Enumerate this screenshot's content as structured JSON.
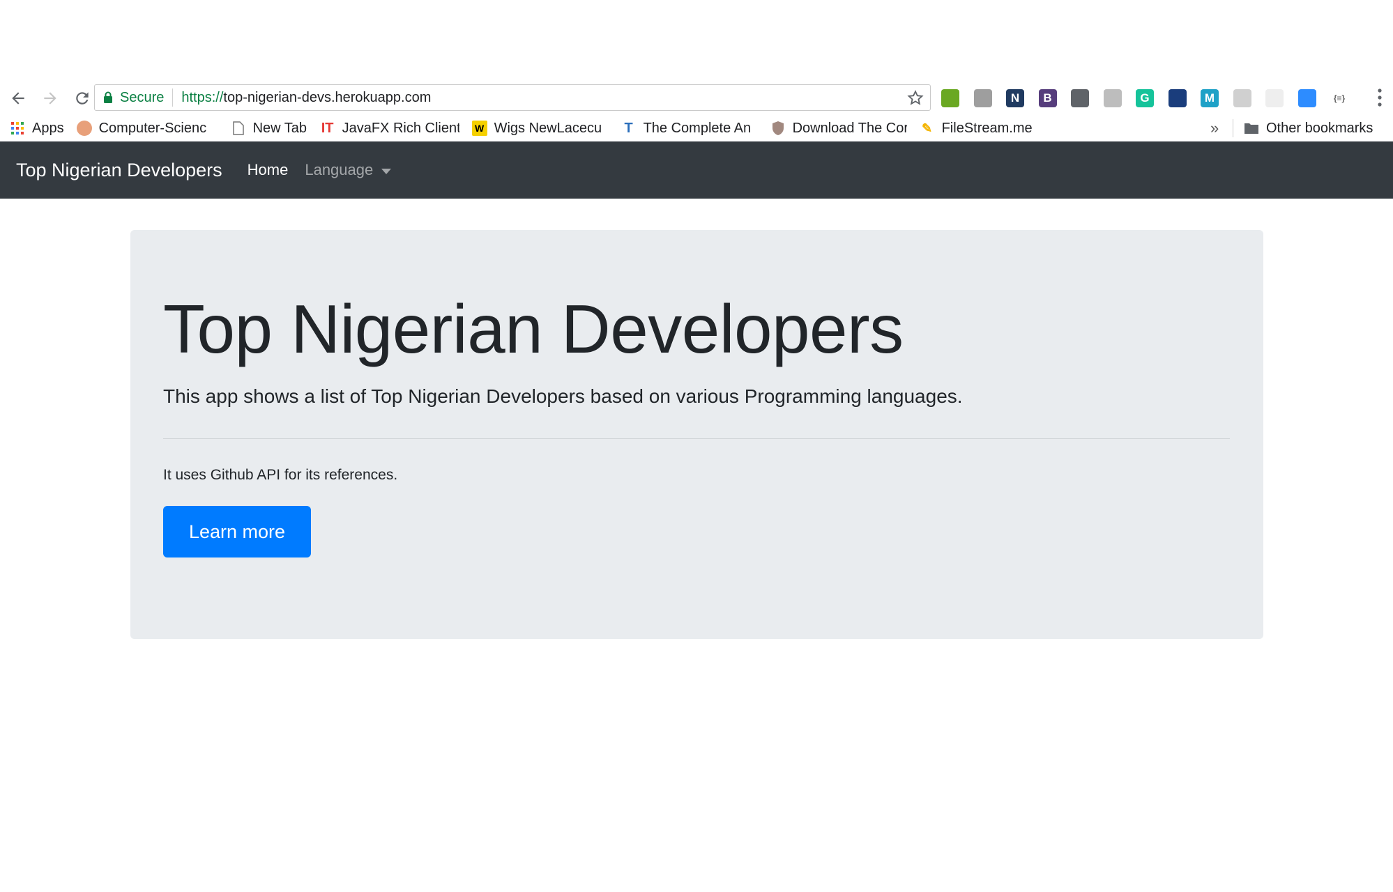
{
  "browser": {
    "secure_label": "Secure",
    "url_scheme": "https://",
    "url_host": "top-nigerian-devs.herokuapp.com",
    "extensions": [
      {
        "icon": "download-arrow-icon",
        "color": "#6aa822",
        "glyph": ""
      },
      {
        "icon": "gray-extension-icon",
        "color": "#9e9e9e",
        "glyph": ""
      },
      {
        "icon": "n-extension-icon",
        "color": "#1f3a60",
        "glyph": "N"
      },
      {
        "icon": "b-extension-icon",
        "color": "#563d7c",
        "glyph": "B"
      },
      {
        "icon": "bulb-extension-icon",
        "color": "#5f6368",
        "glyph": ""
      },
      {
        "icon": "globe-extension-icon",
        "color": "#bdbdbd",
        "glyph": ""
      },
      {
        "icon": "grammarly-icon",
        "color": "#15c39a",
        "glyph": "G"
      },
      {
        "icon": "chart-extension-icon",
        "color": "#1a3d7c",
        "glyph": ""
      },
      {
        "icon": "m-extension-icon",
        "color": "#1ea1c7",
        "glyph": "M"
      },
      {
        "icon": "chat-extension-icon",
        "color": "#d0d0d0",
        "glyph": ""
      },
      {
        "icon": "blank-extension-icon",
        "color": "#eeeeee",
        "glyph": ""
      },
      {
        "icon": "zoom-extension-icon",
        "color": "#2d8cff",
        "glyph": ""
      },
      {
        "icon": "json-extension-icon",
        "color": "#ffffff",
        "glyph": "{≡}"
      }
    ]
  },
  "bookmarks": {
    "apps": "Apps",
    "items": [
      {
        "label": "Computer-Scienc",
        "icon": "computer-science-icon"
      },
      {
        "label": "New Tab",
        "icon": "page-icon"
      },
      {
        "label": "JavaFX Rich Client",
        "icon": "it-icon"
      },
      {
        "label": "Wigs NewLacecu",
        "icon": "wigs-icon"
      },
      {
        "label": "The Complete An",
        "icon": "t-icon"
      },
      {
        "label": "Download The Cor",
        "icon": "shield-icon"
      },
      {
        "label": "FileStream.me",
        "icon": "filestream-icon"
      }
    ],
    "more": "»",
    "other": "Other bookmarks"
  },
  "navbar": {
    "brand": "Top Nigerian Developers",
    "home": "Home",
    "language": "Language"
  },
  "jumbotron": {
    "title": "Top Nigerian Developers",
    "lead": "This app shows a list of Top Nigerian Developers based on various Programming languages.",
    "text": "It uses Github API for its references.",
    "button": "Learn more"
  },
  "colors": {
    "navbar_bg": "#343a40",
    "jumbotron_bg": "#e9ecef",
    "primary": "#007bff",
    "secure_green": "#0b8043"
  }
}
